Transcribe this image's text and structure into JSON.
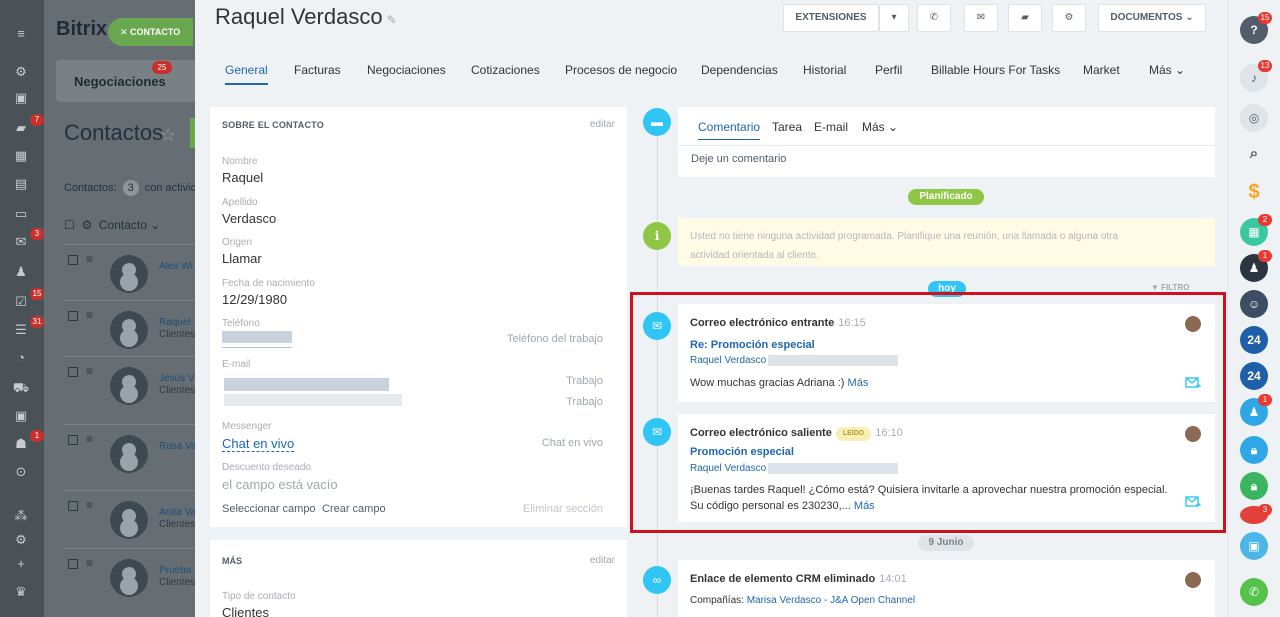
{
  "bg": {
    "logo": "Bitrix",
    "chip": "CONTACTO",
    "deals_tab": "Negociaciones",
    "deals_badge": "25",
    "page_title": "Contactos",
    "filter_prefix": "Contactos:",
    "filter_count": "3",
    "filter_suffix": "con activid",
    "column_header": "Contacto",
    "nav_badges": [
      "7",
      "3",
      "15",
      "31",
      "1"
    ],
    "rows": [
      {
        "name": "Alex Wi",
        "sub": ""
      },
      {
        "name": "Raquel",
        "sub": "Clientes"
      },
      {
        "name": "Jesús V",
        "sub": "Clientes"
      },
      {
        "name": "Rosa Va",
        "sub": ""
      },
      {
        "name": "Anita Va",
        "sub": "Clientes"
      },
      {
        "name": "Prueba",
        "sub": "Clientes"
      }
    ]
  },
  "contact": {
    "title": "Raquel Verdasco",
    "toolbar": {
      "extensions": "EXTENSIONES",
      "documents": "DOCUMENTOS"
    },
    "tabs": [
      "General",
      "Facturas",
      "Negociaciones",
      "Cotizaciones",
      "Procesos de negocio",
      "Dependencias",
      "Historial",
      "Perfil",
      "Billable Hours For Tasks",
      "Market",
      "Más"
    ]
  },
  "about": {
    "header": "SOBRE EL CONTACTO",
    "edit": "editar",
    "name_label": "Nombre",
    "name": "Raquel",
    "surname_label": "Apellido",
    "surname": "Verdasco",
    "source_label": "Origen",
    "source": "Llamar",
    "birth_label": "Fecha de nacimiento",
    "birth": "12/29/1980",
    "phone_label": "Teléfono",
    "phone_type": "Teléfono del trabajo",
    "email_label": "E-mail",
    "email_type1": "Trabajo",
    "email_type2": "Trabajo",
    "messenger_label": "Messenger",
    "messenger": "Chat en vivo",
    "messenger_type": "Chat en vivo",
    "discount_label": "Descuento deseado",
    "discount": "el campo está vacío",
    "select_field": "Seleccionar campo",
    "create_field": "Crear campo",
    "delete_section": "Eliminar sección"
  },
  "mas": {
    "header": "MÁS",
    "edit": "editar",
    "type_label": "Tipo de contacto",
    "type": "Clientes"
  },
  "timeline": {
    "comment_tabs": [
      "Comentario",
      "Tarea",
      "E-mail",
      "Más"
    ],
    "comment_placeholder": "Deje un comentario",
    "planned": "Planificado",
    "no_activity": "Usted no tiene ninguna actividad programada. Planifique una reunión, una llamada o alguna otra actividad orientada al cliente.",
    "today": "hoy",
    "filter": "FILTRO",
    "incoming": {
      "title": "Correo electrónico entrante",
      "time": "16:15",
      "subject": "Re: Promoción especial",
      "from": "Raquel Verdasco",
      "body": "Wow muchas gracias Adriana :)",
      "more": "Más"
    },
    "outgoing": {
      "title": "Correo electrónico saliente",
      "read": "LEÍDO",
      "time": "16:10",
      "subject": "Promoción especial",
      "from": "Raquel Verdasco",
      "body": "¡Buenas tardes Raquel! ¿Cómo está? Quisiera invitarle a aprovechar nuestra promoción especial.  Su código personal es 230230,...",
      "more": "Más"
    },
    "date2": "9 Junio",
    "crm": {
      "title": "Enlace de elemento CRM eliminado",
      "time": "14:01",
      "companies_label": "Compañías:",
      "companies": "Marisa Verdasco - J&A Open Channel"
    }
  },
  "rail": {
    "badges": [
      "15",
      "13",
      "2",
      "1",
      "1",
      "3"
    ],
    "b24": "24"
  },
  "colors": {
    "accent": "#2067b0",
    "timeline_icon": "#2fc6f6",
    "planned": "#8fc646",
    "today": "#2fc6f6",
    "highlight": "#d2101c"
  }
}
